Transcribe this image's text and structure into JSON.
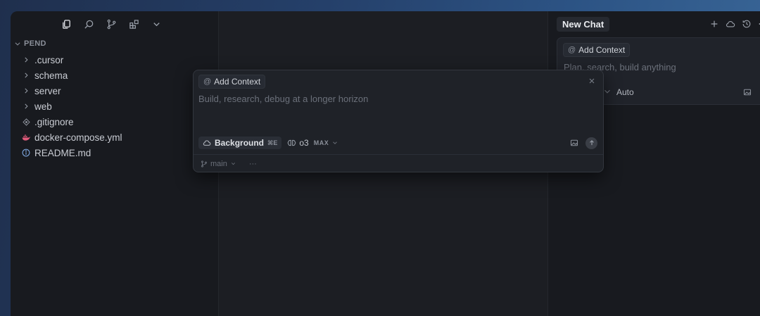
{
  "explorer": {
    "toolbar": [
      "files-icon",
      "search-icon",
      "source-control-icon",
      "extensions-icon",
      "chevron-down-icon"
    ],
    "section_title": "PEND",
    "items": [
      {
        "label": ".cursor",
        "icon": "chevron-right-icon"
      },
      {
        "label": "schema",
        "icon": "chevron-right-icon"
      },
      {
        "label": "server",
        "icon": "chevron-right-icon"
      },
      {
        "label": "web",
        "icon": "chevron-right-icon"
      },
      {
        "label": ".gitignore",
        "icon": "git-icon"
      },
      {
        "label": "docker-compose.yml",
        "icon": "docker-icon"
      },
      {
        "label": "README.md",
        "icon": "info-icon"
      }
    ]
  },
  "chat": {
    "tab_label": "New Chat",
    "add_context": "Add Context",
    "placeholder": "Plan, search, build anything",
    "mode": "Auto"
  },
  "composer": {
    "add_context": "Add Context",
    "placeholder": "Build, research, debug at a longer horizon",
    "background_label": "Background",
    "background_shortcut": "⌘E",
    "model": "o3",
    "model_badge": "MAX",
    "branch": "main",
    "more": "···"
  },
  "colors": {
    "desktop_bg": "#2c5384",
    "window_bg": "#181a1f",
    "composer_bg": "#1f2228",
    "docker_icon": "#e05a7a",
    "info_icon": "#7aa2d8"
  }
}
